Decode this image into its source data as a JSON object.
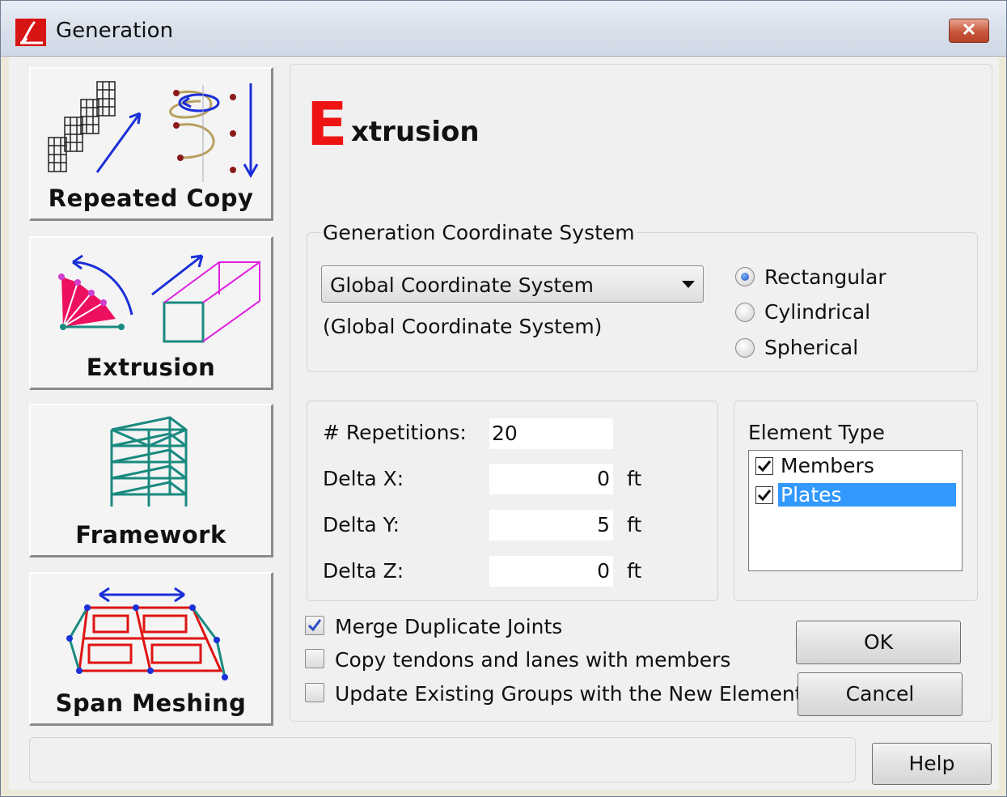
{
  "window": {
    "title": "Generation",
    "close_glyph": "✕",
    "app_icon": "staad-logo-icon"
  },
  "nav": [
    {
      "label": "Repeated Copy",
      "icon": "repeated-copy-icon"
    },
    {
      "label": "Extrusion",
      "icon": "extrusion-icon"
    },
    {
      "label": "Framework",
      "icon": "framework-icon"
    },
    {
      "label": "Span Meshing",
      "icon": "span-meshing-icon"
    }
  ],
  "heading": {
    "initial": "E",
    "rest": "xtrusion",
    "initial_color": "#ee1414"
  },
  "coord_system": {
    "legend": "Generation Coordinate System",
    "selected": "Global Coordinate System",
    "caption": "(Global Coordinate System)",
    "options": [
      {
        "label": "Rectangular",
        "checked": true
      },
      {
        "label": "Cylindrical",
        "checked": false
      },
      {
        "label": "Spherical",
        "checked": false
      }
    ]
  },
  "params": {
    "repetitions_label": "# Repetitions:",
    "repetitions_value": "20",
    "delta_x_label": "Delta X:",
    "delta_x_value": "0",
    "delta_y_label": "Delta Y:",
    "delta_y_value": "5",
    "delta_z_label": "Delta Z:",
    "delta_z_value": "0",
    "unit": "ft"
  },
  "element_type": {
    "legend": "Element Type",
    "items": [
      {
        "label": "Members",
        "checked": true,
        "selected": false
      },
      {
        "label": "Plates",
        "checked": true,
        "selected": true
      }
    ]
  },
  "options": [
    {
      "label": "Merge Duplicate Joints",
      "checked": true
    },
    {
      "label": "Copy tendons and lanes with members",
      "checked": false
    },
    {
      "label": "Update Existing Groups with the New Elements",
      "checked": false
    }
  ],
  "buttons": {
    "ok": "OK",
    "cancel": "Cancel",
    "help": "Help"
  },
  "colors": {
    "selection": "#3399ff",
    "dialog_bg": "#f0f0f0"
  }
}
